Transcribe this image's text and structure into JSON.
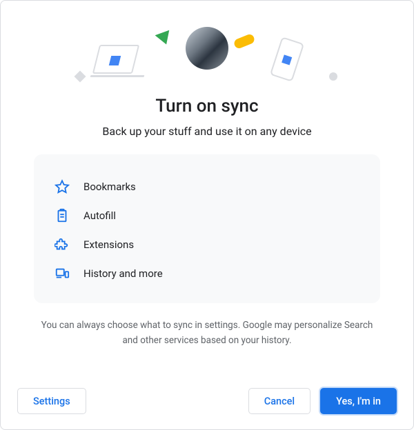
{
  "dialog": {
    "title": "Turn on sync",
    "subtitle": "Back up your stuff and use it on any device",
    "features": [
      {
        "icon": "star-icon",
        "label": "Bookmarks"
      },
      {
        "icon": "clipboard-icon",
        "label": "Autofill"
      },
      {
        "icon": "puzzle-icon",
        "label": "Extensions"
      },
      {
        "icon": "devices-icon",
        "label": "History and more"
      }
    ],
    "disclaimer": "You can always choose what to sync in settings. Google may personalize Search and other services based on your history.",
    "buttons": {
      "settings": "Settings",
      "cancel": "Cancel",
      "confirm": "Yes, I'm in"
    }
  },
  "colors": {
    "accent": "#1a73e8",
    "green": "#34a853",
    "yellow": "#fbbc04"
  }
}
